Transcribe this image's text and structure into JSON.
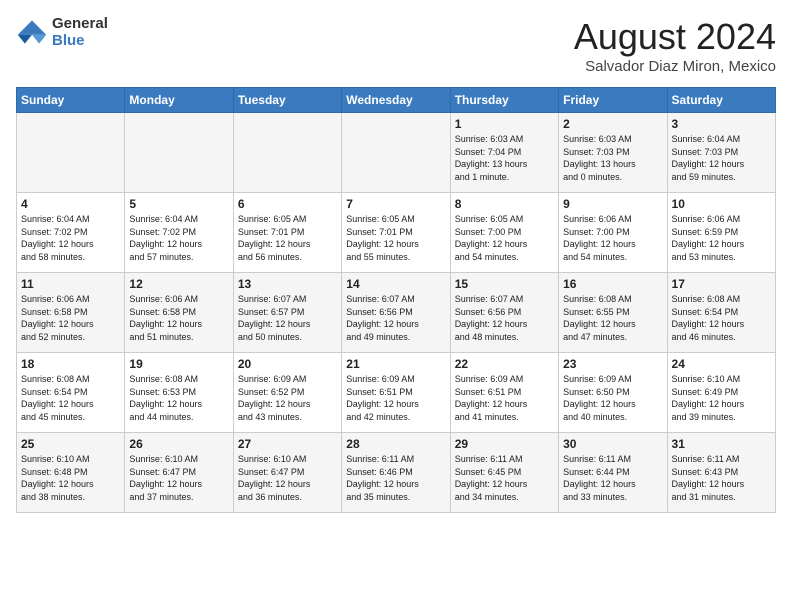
{
  "logo": {
    "general": "General",
    "blue": "Blue"
  },
  "title": {
    "month_year": "August 2024",
    "location": "Salvador Diaz Miron, Mexico"
  },
  "headers": [
    "Sunday",
    "Monday",
    "Tuesday",
    "Wednesday",
    "Thursday",
    "Friday",
    "Saturday"
  ],
  "weeks": [
    [
      {
        "day": "",
        "info": ""
      },
      {
        "day": "",
        "info": ""
      },
      {
        "day": "",
        "info": ""
      },
      {
        "day": "",
        "info": ""
      },
      {
        "day": "1",
        "info": "Sunrise: 6:03 AM\nSunset: 7:04 PM\nDaylight: 13 hours\nand 1 minute."
      },
      {
        "day": "2",
        "info": "Sunrise: 6:03 AM\nSunset: 7:03 PM\nDaylight: 13 hours\nand 0 minutes."
      },
      {
        "day": "3",
        "info": "Sunrise: 6:04 AM\nSunset: 7:03 PM\nDaylight: 12 hours\nand 59 minutes."
      }
    ],
    [
      {
        "day": "4",
        "info": "Sunrise: 6:04 AM\nSunset: 7:02 PM\nDaylight: 12 hours\nand 58 minutes."
      },
      {
        "day": "5",
        "info": "Sunrise: 6:04 AM\nSunset: 7:02 PM\nDaylight: 12 hours\nand 57 minutes."
      },
      {
        "day": "6",
        "info": "Sunrise: 6:05 AM\nSunset: 7:01 PM\nDaylight: 12 hours\nand 56 minutes."
      },
      {
        "day": "7",
        "info": "Sunrise: 6:05 AM\nSunset: 7:01 PM\nDaylight: 12 hours\nand 55 minutes."
      },
      {
        "day": "8",
        "info": "Sunrise: 6:05 AM\nSunset: 7:00 PM\nDaylight: 12 hours\nand 54 minutes."
      },
      {
        "day": "9",
        "info": "Sunrise: 6:06 AM\nSunset: 7:00 PM\nDaylight: 12 hours\nand 54 minutes."
      },
      {
        "day": "10",
        "info": "Sunrise: 6:06 AM\nSunset: 6:59 PM\nDaylight: 12 hours\nand 53 minutes."
      }
    ],
    [
      {
        "day": "11",
        "info": "Sunrise: 6:06 AM\nSunset: 6:58 PM\nDaylight: 12 hours\nand 52 minutes."
      },
      {
        "day": "12",
        "info": "Sunrise: 6:06 AM\nSunset: 6:58 PM\nDaylight: 12 hours\nand 51 minutes."
      },
      {
        "day": "13",
        "info": "Sunrise: 6:07 AM\nSunset: 6:57 PM\nDaylight: 12 hours\nand 50 minutes."
      },
      {
        "day": "14",
        "info": "Sunrise: 6:07 AM\nSunset: 6:56 PM\nDaylight: 12 hours\nand 49 minutes."
      },
      {
        "day": "15",
        "info": "Sunrise: 6:07 AM\nSunset: 6:56 PM\nDaylight: 12 hours\nand 48 minutes."
      },
      {
        "day": "16",
        "info": "Sunrise: 6:08 AM\nSunset: 6:55 PM\nDaylight: 12 hours\nand 47 minutes."
      },
      {
        "day": "17",
        "info": "Sunrise: 6:08 AM\nSunset: 6:54 PM\nDaylight: 12 hours\nand 46 minutes."
      }
    ],
    [
      {
        "day": "18",
        "info": "Sunrise: 6:08 AM\nSunset: 6:54 PM\nDaylight: 12 hours\nand 45 minutes."
      },
      {
        "day": "19",
        "info": "Sunrise: 6:08 AM\nSunset: 6:53 PM\nDaylight: 12 hours\nand 44 minutes."
      },
      {
        "day": "20",
        "info": "Sunrise: 6:09 AM\nSunset: 6:52 PM\nDaylight: 12 hours\nand 43 minutes."
      },
      {
        "day": "21",
        "info": "Sunrise: 6:09 AM\nSunset: 6:51 PM\nDaylight: 12 hours\nand 42 minutes."
      },
      {
        "day": "22",
        "info": "Sunrise: 6:09 AM\nSunset: 6:51 PM\nDaylight: 12 hours\nand 41 minutes."
      },
      {
        "day": "23",
        "info": "Sunrise: 6:09 AM\nSunset: 6:50 PM\nDaylight: 12 hours\nand 40 minutes."
      },
      {
        "day": "24",
        "info": "Sunrise: 6:10 AM\nSunset: 6:49 PM\nDaylight: 12 hours\nand 39 minutes."
      }
    ],
    [
      {
        "day": "25",
        "info": "Sunrise: 6:10 AM\nSunset: 6:48 PM\nDaylight: 12 hours\nand 38 minutes."
      },
      {
        "day": "26",
        "info": "Sunrise: 6:10 AM\nSunset: 6:47 PM\nDaylight: 12 hours\nand 37 minutes."
      },
      {
        "day": "27",
        "info": "Sunrise: 6:10 AM\nSunset: 6:47 PM\nDaylight: 12 hours\nand 36 minutes."
      },
      {
        "day": "28",
        "info": "Sunrise: 6:11 AM\nSunset: 6:46 PM\nDaylight: 12 hours\nand 35 minutes."
      },
      {
        "day": "29",
        "info": "Sunrise: 6:11 AM\nSunset: 6:45 PM\nDaylight: 12 hours\nand 34 minutes."
      },
      {
        "day": "30",
        "info": "Sunrise: 6:11 AM\nSunset: 6:44 PM\nDaylight: 12 hours\nand 33 minutes."
      },
      {
        "day": "31",
        "info": "Sunrise: 6:11 AM\nSunset: 6:43 PM\nDaylight: 12 hours\nand 31 minutes."
      }
    ]
  ]
}
